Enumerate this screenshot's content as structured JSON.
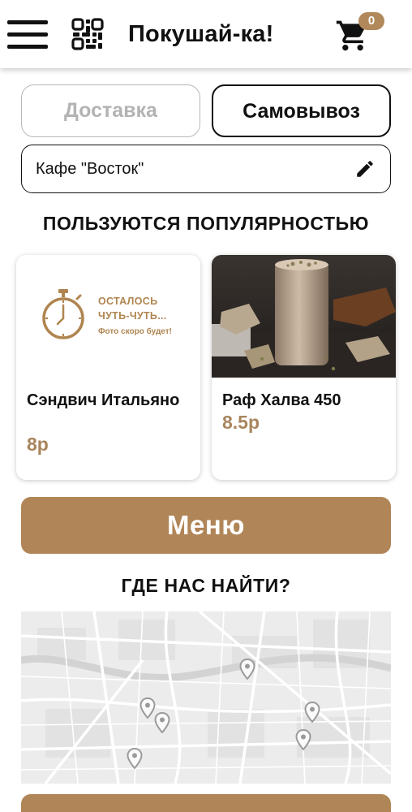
{
  "header": {
    "menu_icon": "hamburger-icon",
    "qr_icon": "qr-code-icon",
    "title": "Покушай-ка!",
    "cart_icon": "shopping-cart-icon",
    "cart_count": "0"
  },
  "order_type": {
    "delivery_label": "Доставка",
    "pickup_label": "Самовывоз",
    "selected": "pickup"
  },
  "cafe": {
    "value": "Кафе \"Восток\"",
    "edit_icon": "pencil-icon"
  },
  "popular": {
    "title": "ПОЛЬЗУЮТСЯ ПОПУЛЯРНОСТЬЮ",
    "items": [
      {
        "name": "Сэндвич Итальяно",
        "price": "8р",
        "placeholder": {
          "icon": "stopwatch-icon",
          "line1": "ОСТАЛОСЬ",
          "line2": "ЧУТЬ-ЧУТЬ...",
          "line3": "Фото скоро будет!"
        }
      },
      {
        "name": "Раф Халва 450",
        "price": "8.5р",
        "image": "raf-halva-drink-photo"
      }
    ]
  },
  "menu_button": {
    "label": "Меню"
  },
  "find_us": {
    "title": "ГДЕ НАС НАЙТИ?",
    "pin_icon": "map-pin-icon",
    "pin_count": 6
  },
  "colors": {
    "accent": "#b08557",
    "price": "#a9855d",
    "badge": "#b0885a"
  }
}
